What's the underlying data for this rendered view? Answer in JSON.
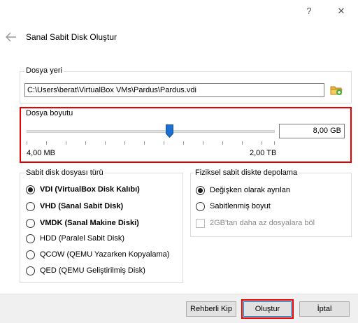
{
  "titlebar": {
    "help": "?",
    "close": "✕"
  },
  "page_title": "Sanal Sabit Disk Oluştur",
  "file_location": {
    "legend": "Dosya yeri",
    "path": "C:\\Users\\berat\\VirtualBox VMs\\Pardus\\Pardus.vdi"
  },
  "file_size": {
    "legend": "Dosya boyutu",
    "value": "8,00 GB",
    "min_label": "4,00 MB",
    "max_label": "2,00 TB"
  },
  "disk_type": {
    "legend": "Sabit disk dosyası türü",
    "options": [
      {
        "label": "VDI (VirtualBox Disk Kalıbı)",
        "checked": true,
        "bold": true
      },
      {
        "label": "VHD (Sanal Sabit Disk)",
        "checked": false,
        "bold": true
      },
      {
        "label": "VMDK (Sanal Makine Diski)",
        "checked": false,
        "bold": true
      },
      {
        "label": "HDD (Paralel Sabit Disk)",
        "checked": false,
        "bold": false
      },
      {
        "label": "QCOW (QEMU Yazarken Kopyalama)",
        "checked": false,
        "bold": false
      },
      {
        "label": "QED (QEMU Geliştirilmiş Disk)",
        "checked": false,
        "bold": false
      }
    ]
  },
  "storage": {
    "legend": "Fiziksel sabit diskte depolama",
    "options": [
      {
        "label": "Değişken olarak ayrılan",
        "checked": true
      },
      {
        "label": "Sabitlenmiş boyut",
        "checked": false
      }
    ],
    "split_label": "2GB'tan daha az dosyalara böl"
  },
  "buttons": {
    "expert": "Rehberli Kip",
    "create": "Oluştur",
    "cancel": "İptal"
  },
  "colors": {
    "highlight": "#e60000",
    "accent": "#1a6fd1"
  }
}
